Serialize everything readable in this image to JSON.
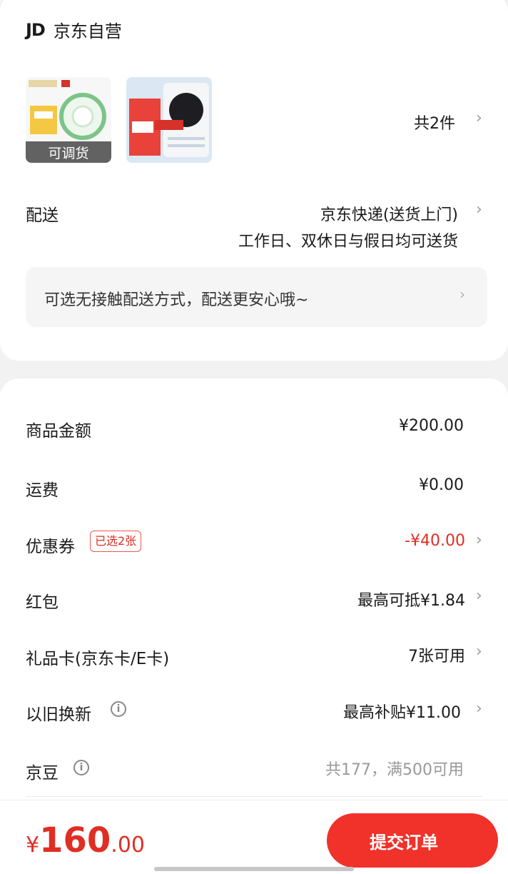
{
  "shop": {
    "logo": "JD",
    "name": "京东自营"
  },
  "items": {
    "count_text": "共2件",
    "thumb1_band": "可调货"
  },
  "delivery": {
    "label": "配送",
    "method": "京东快递(送货上门)",
    "schedule": "工作日、双休日与假日均可送货",
    "notice": "可选无接触配送方式，配送更安心哦~"
  },
  "price": {
    "goods": {
      "label": "商品金额",
      "value": "¥200.00"
    },
    "shipping": {
      "label": "运费",
      "value": "¥0.00"
    },
    "coupon": {
      "label": "优惠券",
      "badge": "已选2张",
      "value": "-¥40.00"
    },
    "redpacket": {
      "label": "红包",
      "value": "最高可抵¥1.84"
    },
    "giftcard": {
      "label": "礼品卡(京东卡/E卡)",
      "value": "7张可用"
    },
    "tradein": {
      "label": "以旧换新",
      "value": "最高补贴¥11.00"
    },
    "jdbean": {
      "label": "京豆",
      "value": "共177，满500可用"
    }
  },
  "footer": {
    "currency": "¥",
    "total_int": "160",
    "total_dec": ".00",
    "submit_label": "提交订单"
  },
  "colors": {
    "accent": "#e02e24",
    "submit_bg": "#f0322a"
  }
}
